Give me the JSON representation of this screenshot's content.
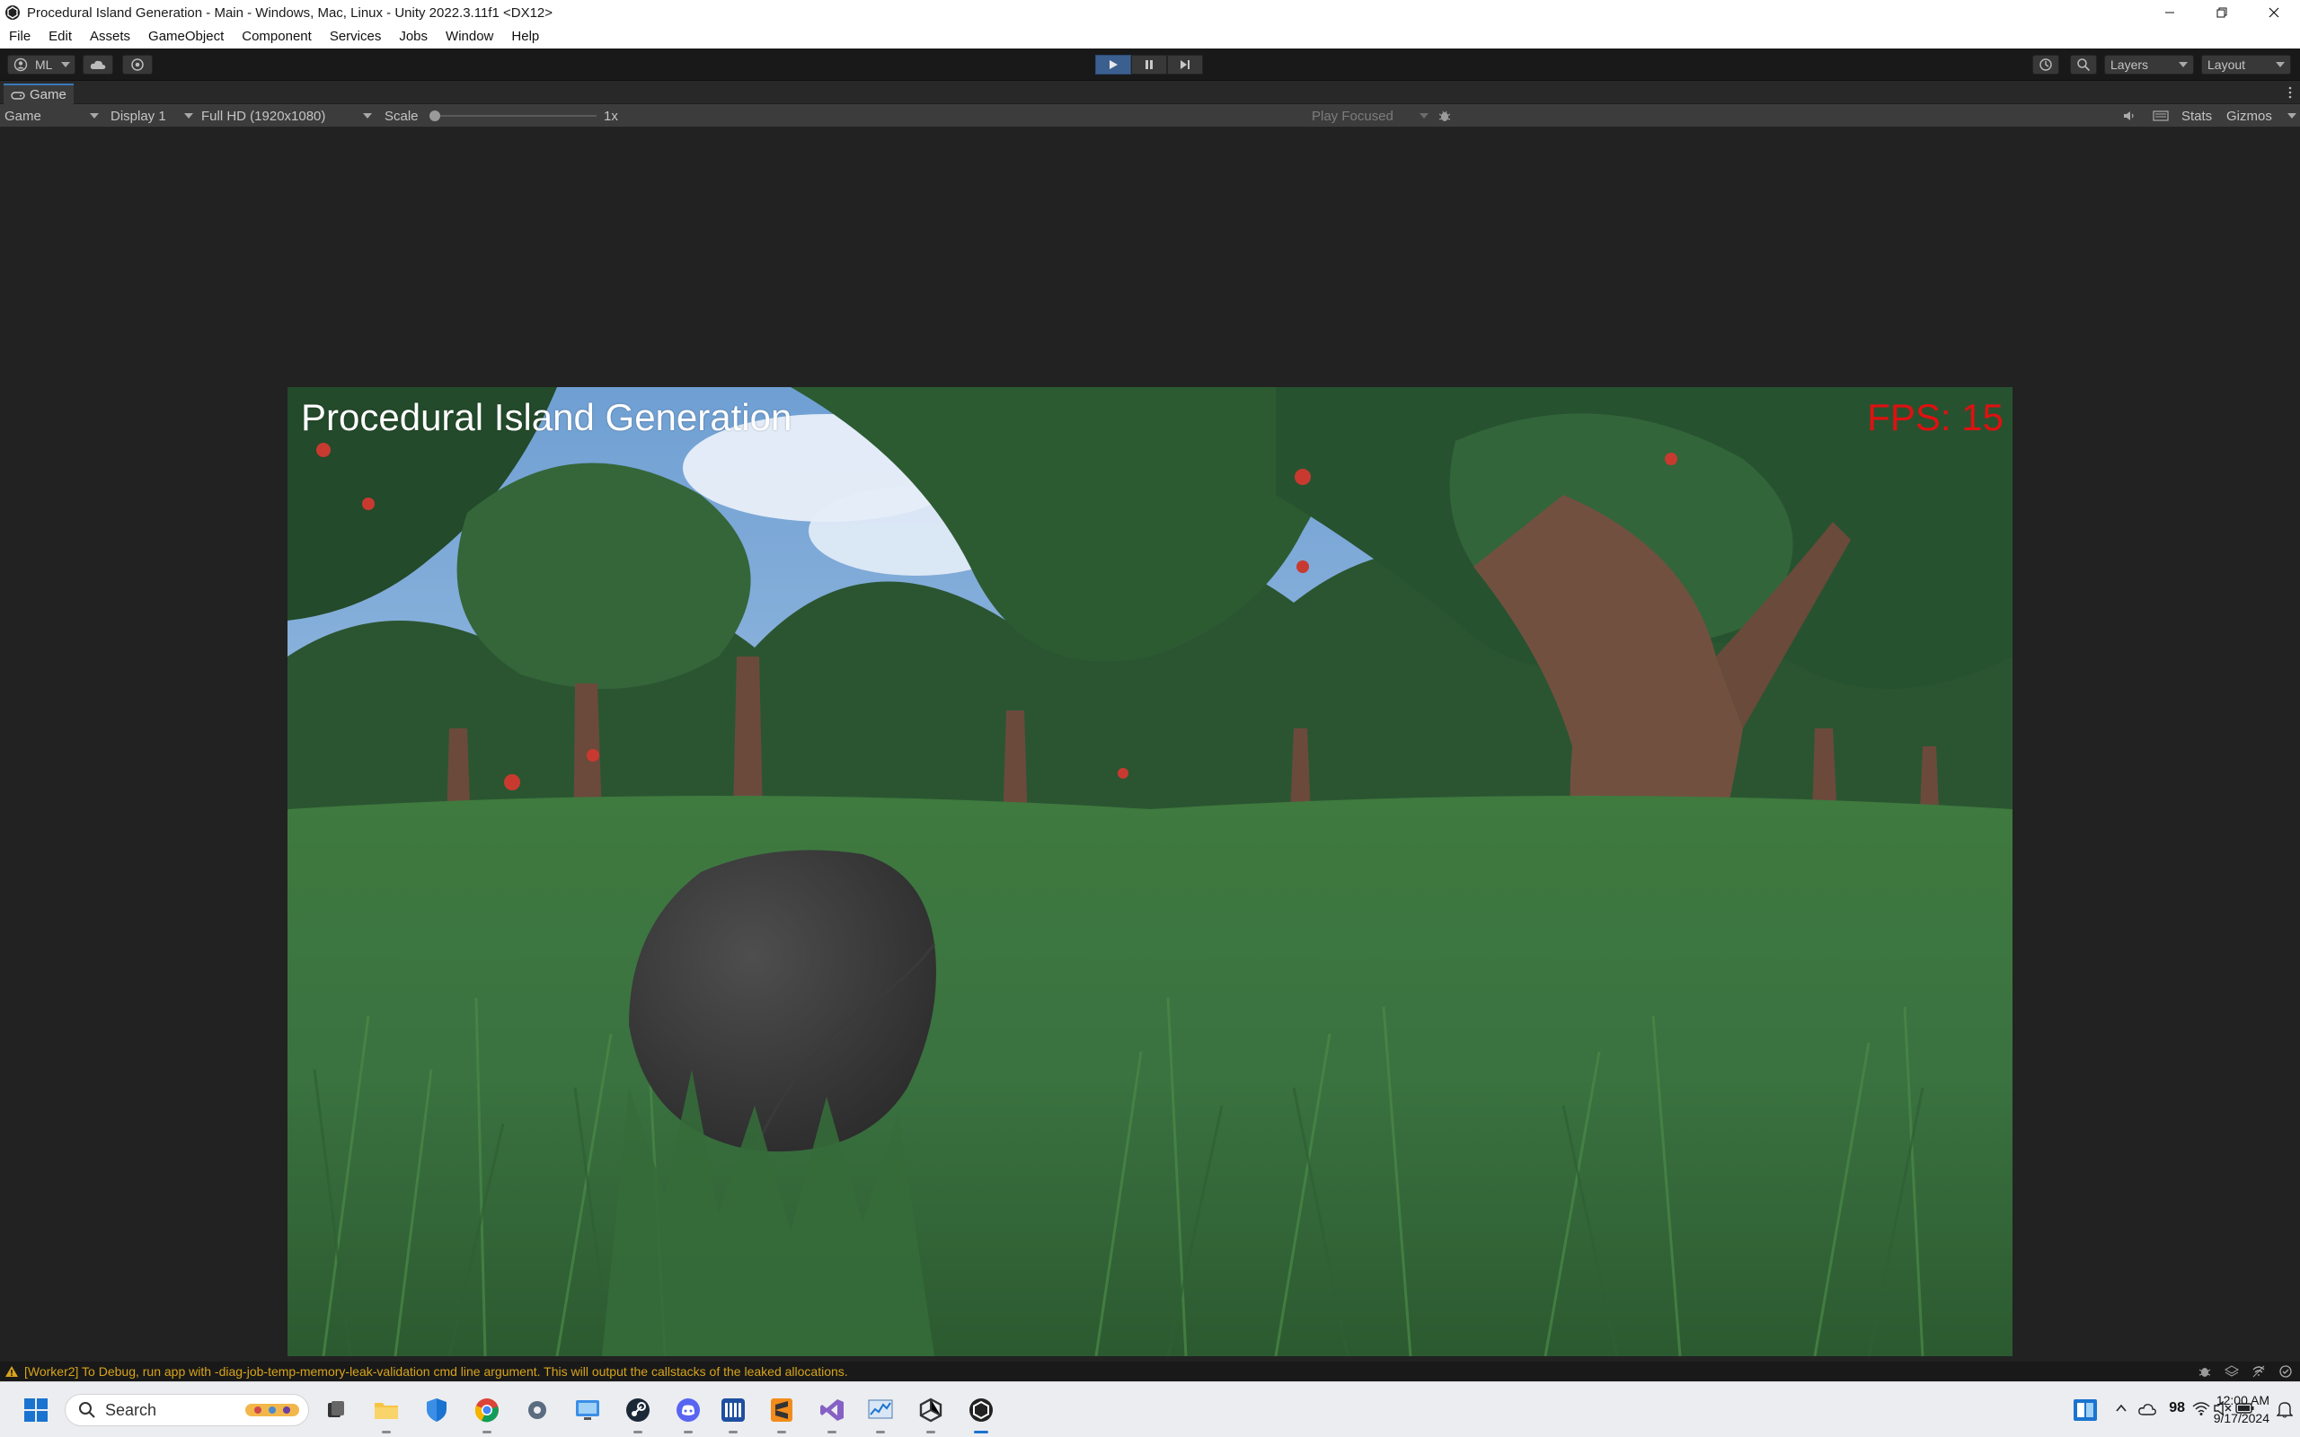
{
  "window": {
    "title": "Procedural Island Generation - Main - Windows, Mac, Linux - Unity 2022.3.11f1 <DX12>"
  },
  "menu": [
    "File",
    "Edit",
    "Assets",
    "GameObject",
    "Component",
    "Services",
    "Jobs",
    "Window",
    "Help"
  ],
  "toolbar": {
    "account_label": "ML",
    "layers_label": "Layers",
    "layout_label": "Layout"
  },
  "game_tab": {
    "label": "Game"
  },
  "game_view": {
    "view_mode": "Game",
    "display": "Display 1",
    "resolution": "Full HD (1920x1080)",
    "scale_label": "Scale",
    "scale_value": "1x",
    "play_mode": "Play Focused",
    "stats_label": "Stats",
    "gizmos_label": "Gizmos"
  },
  "hud": {
    "title": "Procedural Island Generation",
    "fps": "FPS: 15"
  },
  "status": {
    "message": "[Worker2] To Debug, run app with -diag-job-temp-memory-leak-validation cmd line argument. This will output the callstacks of the leaked allocations."
  },
  "taskbar": {
    "search_placeholder": "Search",
    "time": "12:00 AM",
    "date": "9/17/2024",
    "tray_badge": "98",
    "pinned": [
      "start-icon",
      "search-icon",
      "task-view-icon",
      "file-explorer-icon",
      "defender-icon",
      "chrome-icon",
      "settings-icon",
      "remote-desktop-icon",
      "steam-icon",
      "discord-icon",
      "audio-app-icon",
      "sublime-text-icon",
      "visual-studio-icon",
      "performance-monitor-icon",
      "unity-hub-icon",
      "unity-editor-icon"
    ]
  },
  "colors": {
    "accent": "#3a79bb",
    "fps_text": "#e01010",
    "warning": "#d7a41a",
    "sky": "#8fb7dd",
    "grass": "#3c7a3f"
  }
}
